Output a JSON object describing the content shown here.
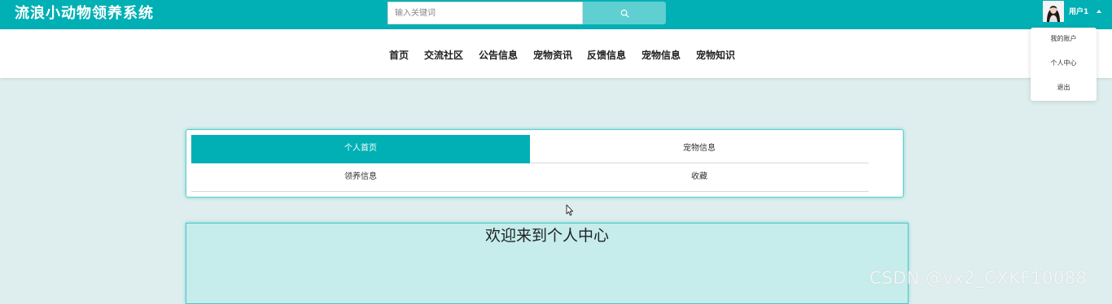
{
  "header": {
    "title": "流浪小动物领养系统",
    "search_placeholder": "输入关键词",
    "user_label": "用户1"
  },
  "nav": {
    "items": [
      "首页",
      "交流社区",
      "公告信息",
      "宠物资讯",
      "反馈信息",
      "宠物信息",
      "宠物知识"
    ]
  },
  "dropdown": {
    "items": [
      "我的账户",
      "个人中心",
      "退出"
    ]
  },
  "center_menu": {
    "items": [
      {
        "label": "个人首页",
        "active": true
      },
      {
        "label": "宠物信息",
        "active": false
      },
      {
        "label": "领养信息",
        "active": false
      },
      {
        "label": "收藏",
        "active": false
      }
    ]
  },
  "welcome": {
    "text": "欢迎来到个人中心"
  },
  "watermark": "CSDN @vx2_CXKF10088",
  "colors": {
    "primary": "#00b0b4",
    "search_button": "#5fcfd1",
    "page_background": "#deeeee",
    "welcome_background": "#c6ecec"
  },
  "icons": {
    "search": "search-icon",
    "avatar": "user-avatar",
    "caret": "caret-up-icon",
    "cursor": "mouse-pointer-icon"
  }
}
